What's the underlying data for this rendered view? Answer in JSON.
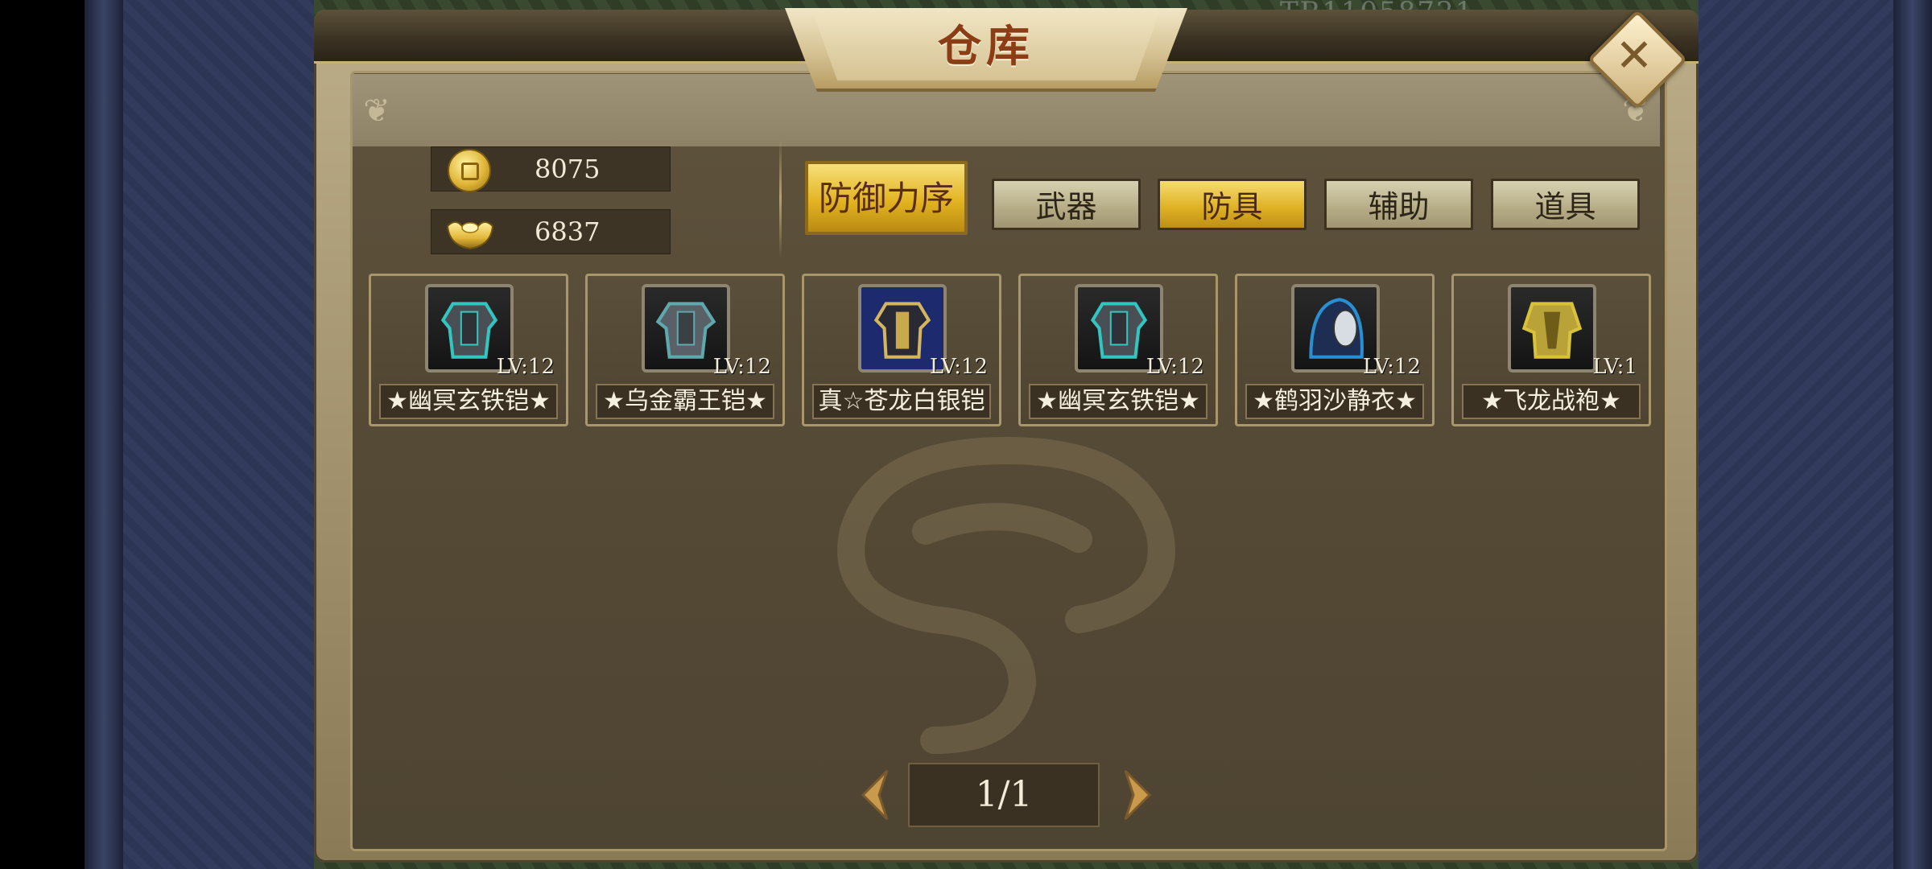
{
  "window": {
    "title": "仓库",
    "close_label": "✕"
  },
  "background_text": "TR11058721",
  "currency": [
    {
      "icon": "coin-icon",
      "value": "8075"
    },
    {
      "icon": "gold-ingot-icon",
      "value": "6837"
    }
  ],
  "sort_button": {
    "label": "防御力序"
  },
  "tabs": [
    {
      "label": "武器",
      "active": false
    },
    {
      "label": "防具",
      "active": true
    },
    {
      "label": "辅助",
      "active": false
    },
    {
      "label": "道具",
      "active": false
    }
  ],
  "items": [
    {
      "name": "★幽冥玄铁铠★",
      "level": "LV:12",
      "icon": "armor-icon",
      "color": "#33c6c0"
    },
    {
      "name": "★乌金霸王铠★",
      "level": "LV:12",
      "icon": "armor-icon",
      "color": "#5fa8ac"
    },
    {
      "name": "真☆苍龙白银铠",
      "level": "LV:12",
      "icon": "armor-icon",
      "color": "#d4b660"
    },
    {
      "name": "★幽冥玄铁铠★",
      "level": "LV:12",
      "icon": "armor-icon",
      "color": "#33c6c0"
    },
    {
      "name": "★鹤羽沙静衣★",
      "level": "LV:12",
      "icon": "robe-icon",
      "color": "#2a8fd0"
    },
    {
      "name": "★飞龙战袍★",
      "level": "LV:1",
      "icon": "robe-icon",
      "color": "#d8c23a"
    }
  ],
  "pagination": {
    "label": "1/1"
  },
  "colors": {
    "accent_gold": "#e0b327",
    "title_red": "#8b3d16",
    "panel": "#564b36"
  }
}
